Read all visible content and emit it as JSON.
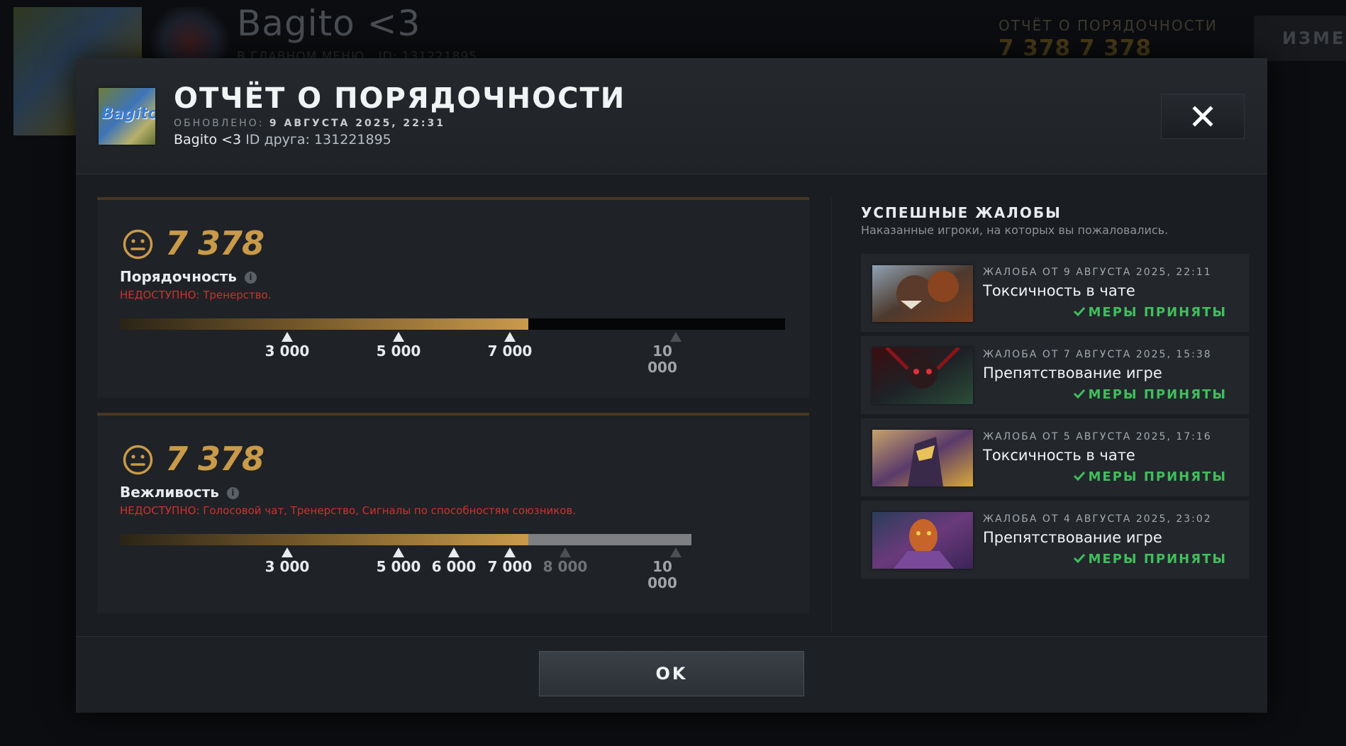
{
  "background": {
    "player_name": "Bagito <3",
    "status_text": "В ГЛАВНОМ МЕНЮ",
    "id_text": "ID: 131221895",
    "report_label": "ОТЧЁТ О ПОРЯДОЧНОСТИ",
    "report_values": "7 378  7 378",
    "edit_label": "ИЗМЕН"
  },
  "header": {
    "title": "ОТЧЁТ О ПОРЯДОЧНОСТИ",
    "updated_label": "ОБНОВЛЕНО:",
    "updated_value": "9 АВГУСТА 2025, 22:31",
    "player_name": "Bagito <3",
    "friend_id": "ID друга: 131221895",
    "avatar_text": "Bagito"
  },
  "conduct": {
    "score": "7 378",
    "label": "Порядочность",
    "unavailable": "НЕДОСТУПНО:  Тренерство.",
    "ticks": [
      "3 000",
      "5 000",
      "7 000",
      "10 000"
    ]
  },
  "behavior": {
    "score": "7 378",
    "label": "Вежливость",
    "unavailable": "НЕДОСТУПНО:  Голосовой чат, Тренерство, Сигналы по способностям союзников.",
    "ticks": [
      "3 000",
      "5 000",
      "6 000",
      "7 000",
      "8 000",
      "10 000"
    ]
  },
  "reports": {
    "title": "УСПЕШНЫЕ ЖАЛОБЫ",
    "subtitle": "Наказанные игроки, на которых вы пожаловались.",
    "items": [
      {
        "date": "ЖАЛОБА ОТ 9 АВГУСТА 2025, 22:11",
        "reason": "Токсичность в чате",
        "status": "МЕРЫ ПРИНЯТЫ"
      },
      {
        "date": "ЖАЛОБА ОТ 7 АВГУСТА 2025, 15:38",
        "reason": "Препятствование игре",
        "status": "МЕРЫ ПРИНЯТЫ"
      },
      {
        "date": "ЖАЛОБА ОТ 5 АВГУСТА 2025, 17:16",
        "reason": "Токсичность в чате",
        "status": "МЕРЫ ПРИНЯТЫ"
      },
      {
        "date": "ЖАЛОБА ОТ 4 АВГУСТА 2025, 23:02",
        "reason": "Препятствование игре",
        "status": "МЕРЫ ПРИНЯТЫ"
      }
    ]
  },
  "footer": {
    "ok_label": "OK"
  },
  "colors": {
    "accent": "#c89a49",
    "unavailable": "#d0302f",
    "success": "#3fbf5b"
  }
}
